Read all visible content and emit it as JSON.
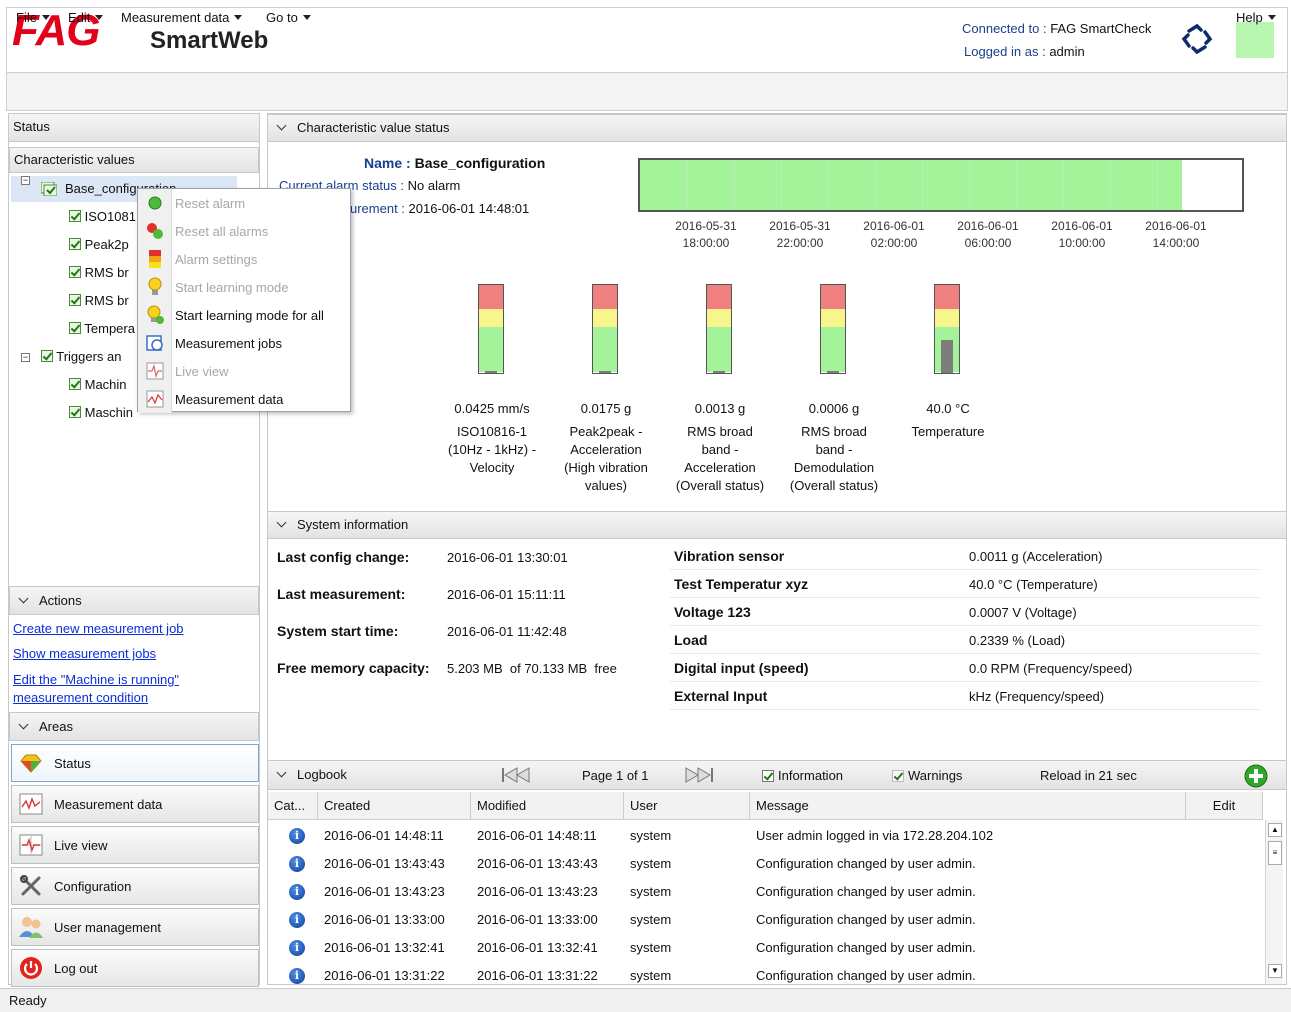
{
  "header": {
    "logo": "FAG",
    "product": "SmartWeb",
    "connected_label": "Connected to :",
    "connected_value": "FAG SmartCheck",
    "logged_label": "Logged in as :",
    "logged_value": "admin",
    "led_color": "#b8f5b0"
  },
  "menu": {
    "file": "File",
    "edit": "Edit",
    "measurement": "Measurement data",
    "goto": "Go to",
    "help": "Help"
  },
  "left": {
    "status_title": "Status",
    "char_values_title": "Characteristic values",
    "tree": [
      "Base_configuration",
      "ISO1081",
      "Peak2p",
      "RMS br",
      "RMS br",
      "Tempera",
      "Triggers an",
      "Machin",
      "Maschin"
    ],
    "actions_title": "Actions",
    "actions": [
      "Create new measurement job",
      "Show measurement jobs",
      "Edit the \"Machine is running\"",
      "measurement condition"
    ],
    "areas_title": "Areas",
    "areas": [
      "Status",
      "Measurement data",
      "Live view",
      "Configuration",
      "User management",
      "Log out"
    ]
  },
  "context_menu": [
    {
      "label": "Reset alarm",
      "enabled": false
    },
    {
      "label": "Reset all alarms",
      "enabled": false
    },
    {
      "label": "Alarm settings",
      "enabled": false
    },
    {
      "label": "Start learning mode",
      "enabled": false
    },
    {
      "label": "Start learning mode for all",
      "enabled": true
    },
    {
      "label": "Measurement jobs",
      "enabled": true
    },
    {
      "label": "Live view",
      "enabled": false
    },
    {
      "label": "Measurement data",
      "enabled": true
    }
  ],
  "char_status": {
    "title": "Characteristic value status",
    "name_label": "Name :",
    "name_value": "Base_configuration",
    "alarm_label": "Current alarm status :",
    "alarm_value": "No alarm",
    "meas_label": "urement :",
    "meas_value": "2016-06-01 14:48:01",
    "timeline_fill_color": "#a4f29a",
    "timeline_fill_fraction": 0.9,
    "timeline_ticks": [
      [
        "2016-05-31",
        "18:00:00"
      ],
      [
        "2016-05-31",
        "22:00:00"
      ],
      [
        "2016-06-01",
        "02:00:00"
      ],
      [
        "2016-06-01",
        "06:00:00"
      ],
      [
        "2016-06-01",
        "10:00:00"
      ],
      [
        "2016-06-01",
        "14:00:00"
      ]
    ],
    "meters": [
      {
        "value": "0.0425 mm/s",
        "name": [
          "ISO10816-1",
          "(10Hz - 1kHz) -",
          "Velocity"
        ],
        "level": 0.0
      },
      {
        "value": "0.0175 g",
        "name": [
          "Peak2peak -",
          "Acceleration",
          "(High vibration",
          "values)"
        ],
        "level": 0.0
      },
      {
        "value": "0.0013 g",
        "name": [
          "RMS broad",
          "band -",
          "Acceleration",
          "(Overall status)"
        ],
        "level": 0.0
      },
      {
        "value": "0.0006 g",
        "name": [
          "RMS broad",
          "band -",
          "Demodulation",
          "(Overall status)"
        ],
        "level": 0.0
      },
      {
        "value": "40.0 °C",
        "name": [
          "Temperature"
        ],
        "level": 0.38
      }
    ]
  },
  "system": {
    "title": "System information",
    "left": [
      {
        "k": "Last config change:",
        "v": "2016-06-01 13:30:01"
      },
      {
        "k": "Last measurement:",
        "v": "2016-06-01 15:11:11"
      },
      {
        "k": "System start time:",
        "v": "2016-06-01 11:42:48"
      },
      {
        "k": "Free memory capacity:",
        "v": "5.203 MB  of 70.133 MB  free"
      }
    ],
    "right": [
      {
        "k": "Vibration sensor",
        "v": "0.0011 g (Acceleration)"
      },
      {
        "k": "Test Temperatur xyz",
        "v": "40.0 °C (Temperature)"
      },
      {
        "k": "Voltage 123",
        "v": "0.0007 V (Voltage)"
      },
      {
        "k": "Load",
        "v": "0.2339 % (Load)"
      },
      {
        "k": "Digital input (speed)",
        "v": "0.0 RPM (Frequency/speed)"
      },
      {
        "k": "External Input",
        "v": "kHz (Frequency/speed)"
      }
    ]
  },
  "logbook": {
    "title": "Logbook",
    "page": "Page 1 of 1",
    "info_label": "Information",
    "warn_label": "Warnings",
    "reload": "Reload in 21 sec",
    "columns": [
      "Cat...",
      "Created",
      "Modified",
      "User",
      "Message",
      "Edit"
    ],
    "rows": [
      [
        "2016-06-01 14:48:11",
        "2016-06-01 14:48:11",
        "system",
        "User admin logged in via 172.28.204.102"
      ],
      [
        "2016-06-01 13:43:43",
        "2016-06-01 13:43:43",
        "system",
        "Configuration changed by user admin."
      ],
      [
        "2016-06-01 13:43:23",
        "2016-06-01 13:43:23",
        "system",
        "Configuration changed by user admin."
      ],
      [
        "2016-06-01 13:33:00",
        "2016-06-01 13:33:00",
        "system",
        "Configuration changed by user admin."
      ],
      [
        "2016-06-01 13:32:41",
        "2016-06-01 13:32:41",
        "system",
        "Configuration changed by user admin."
      ],
      [
        "2016-06-01 13:31:22",
        "2016-06-01 13:31:22",
        "system",
        "Configuration changed by user admin."
      ]
    ]
  },
  "statusbar": "Ready"
}
